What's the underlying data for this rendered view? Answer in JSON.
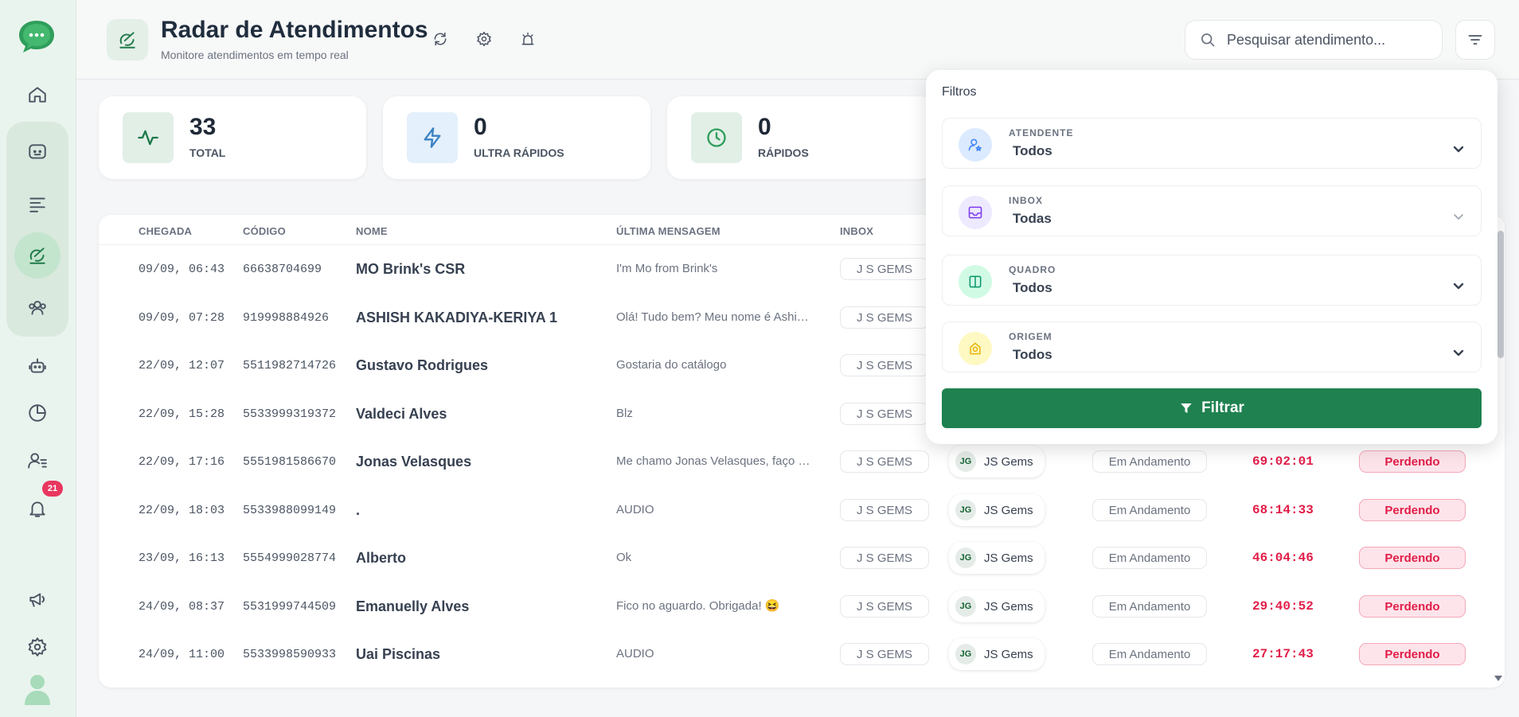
{
  "sidebar": {
    "notification_count": "21",
    "items": [
      {
        "name": "home-icon"
      },
      {
        "name": "chat-icon"
      },
      {
        "name": "list-icon"
      },
      {
        "name": "radar-icon"
      },
      {
        "name": "team-icon"
      },
      {
        "name": "bot-icon"
      },
      {
        "name": "pie-chart-icon"
      },
      {
        "name": "contacts-icon"
      },
      {
        "name": "bell-icon"
      },
      {
        "name": "megaphone-icon"
      },
      {
        "name": "gear-icon"
      }
    ]
  },
  "header": {
    "title": "Radar de Atendimentos",
    "subtitle": "Monitore atendimentos em tempo real",
    "search_placeholder": "Pesquisar atendimento..."
  },
  "stats": [
    {
      "value": "33",
      "label": "TOTAL"
    },
    {
      "value": "0",
      "label": "ULTRA RÁPIDOS"
    },
    {
      "value": "0",
      "label": "RÁPIDOS"
    }
  ],
  "table": {
    "headers": [
      "CHEGADA",
      "CÓDIGO",
      "NOME",
      "ÚLTIMA MENSAGEM",
      "INBOX"
    ],
    "rows": [
      {
        "chegada": "09/09, 06:43",
        "codigo": "66638704699",
        "nome": "MO Brink's CSR",
        "mensagem": "I'm Mo from Brink's",
        "inbox": "J S GEMS",
        "agent_initials": "",
        "agent": "",
        "status": "",
        "tempo": "",
        "sla": ""
      },
      {
        "chegada": "09/09, 07:28",
        "codigo": "919998884926",
        "nome": "ASHISH KAKADIYA-KERIYA 1",
        "mensagem": "Olá! Tudo bem? Meu nome é Ashish Kakadiya",
        "inbox": "J S GEMS",
        "agent_initials": "",
        "agent": "",
        "status": "",
        "tempo": "",
        "sla": ""
      },
      {
        "chegada": "22/09, 12:07",
        "codigo": "5511982714726",
        "nome": "Gustavo Rodrigues",
        "mensagem": "Gostaria do catálogo",
        "inbox": "J S GEMS",
        "agent_initials": "",
        "agent": "",
        "status": "",
        "tempo": "",
        "sla": ""
      },
      {
        "chegada": "22/09, 15:28",
        "codigo": "5533999319372",
        "nome": "Valdeci Alves",
        "mensagem": "Blz",
        "inbox": "J S GEMS",
        "agent_initials": "",
        "agent": "",
        "status": "",
        "tempo": "",
        "sla": ""
      },
      {
        "chegada": "22/09, 17:16",
        "codigo": "5551981586670",
        "nome": "Jonas Velasques",
        "mensagem": "Me chamo Jonas Velasques, faço parte",
        "inbox": "J S GEMS",
        "agent_initials": "JG",
        "agent": "JS Gems",
        "status": "Em Andamento",
        "tempo": "69:02:01",
        "sla": "Perdendo"
      },
      {
        "chegada": "22/09, 18:03",
        "codigo": "5533988099149",
        "nome": ".",
        "mensagem": "AUDIO",
        "inbox": "J S GEMS",
        "agent_initials": "JG",
        "agent": "JS Gems",
        "status": "Em Andamento",
        "tempo": "68:14:33",
        "sla": "Perdendo"
      },
      {
        "chegada": "23/09, 16:13",
        "codigo": "5554999028774",
        "nome": "Alberto",
        "mensagem": "Ok",
        "inbox": "J S GEMS",
        "agent_initials": "JG",
        "agent": "JS Gems",
        "status": "Em Andamento",
        "tempo": "46:04:46",
        "sla": "Perdendo"
      },
      {
        "chegada": "24/09, 08:37",
        "codigo": "5531999744509",
        "nome": "Emanuelly Alves",
        "mensagem": "Fico no aguardo. Obrigada! 😆",
        "inbox": "J S GEMS",
        "agent_initials": "JG",
        "agent": "JS Gems",
        "status": "Em Andamento",
        "tempo": "29:40:52",
        "sla": "Perdendo"
      },
      {
        "chegada": "24/09, 11:00",
        "codigo": "5533998590933",
        "nome": "Uai Piscinas",
        "mensagem": "AUDIO",
        "inbox": "J S GEMS",
        "agent_initials": "JG",
        "agent": "JS Gems",
        "status": "Em Andamento",
        "tempo": "27:17:43",
        "sla": "Perdendo"
      }
    ]
  },
  "filters": {
    "title": "Filtros",
    "fields": [
      {
        "label": "ATENDENTE",
        "value": "Todos",
        "icon": "user-star-icon",
        "color": "#3b82f6",
        "bg": "#dbeafe"
      },
      {
        "label": "INBOX",
        "value": "Todas",
        "icon": "inbox-icon",
        "color": "#7c3aed",
        "bg": "#ede9fe"
      },
      {
        "label": "QUADRO",
        "value": "Todos",
        "icon": "columns-icon",
        "color": "#059669",
        "bg": "#d1fae5"
      },
      {
        "label": "ORIGEM",
        "value": "Todos",
        "icon": "origin-icon",
        "color": "#eab308",
        "bg": "#fef9c3"
      }
    ],
    "submit_label": "Filtrar"
  },
  "colors": {
    "brand": "#1f8150",
    "danger": "#e11d48",
    "sidebar_bg": "#eaf4ee"
  }
}
